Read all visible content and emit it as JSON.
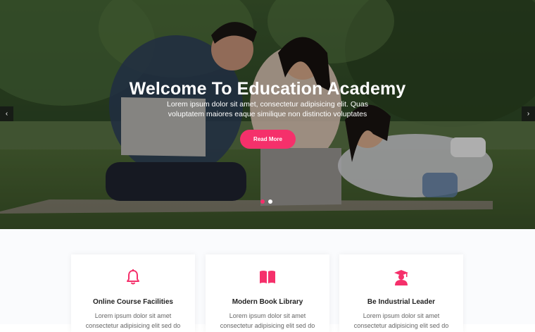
{
  "hero": {
    "title": "Welcome To Education Academy",
    "subtitle": "Lorem ipsum dolor sit amet, consectetur adipisicing elit. Quas voluptatem maiores eaque similique non distinctio voluptates",
    "button_label": "Read More",
    "prev_arrow": "‹",
    "next_arrow": "›",
    "slides_count": 2,
    "active_slide": 1
  },
  "features": [
    {
      "icon": "bell-icon",
      "title": "Online Course Facilities",
      "description": "Lorem ipsum dolor sit amet consectetur adipisicing elit sed do"
    },
    {
      "icon": "book-icon",
      "title": "Modern Book Library",
      "description": "Lorem ipsum dolor sit amet consectetur adipisicing elit sed do"
    },
    {
      "icon": "graduate-icon",
      "title": "Be Industrial Leader",
      "description": "Lorem ipsum dolor sit amet consectetur adipisicing elit sed do"
    }
  ],
  "colors": {
    "accent": "#f5306b",
    "text_dark": "#222222",
    "text_muted": "#666666"
  }
}
